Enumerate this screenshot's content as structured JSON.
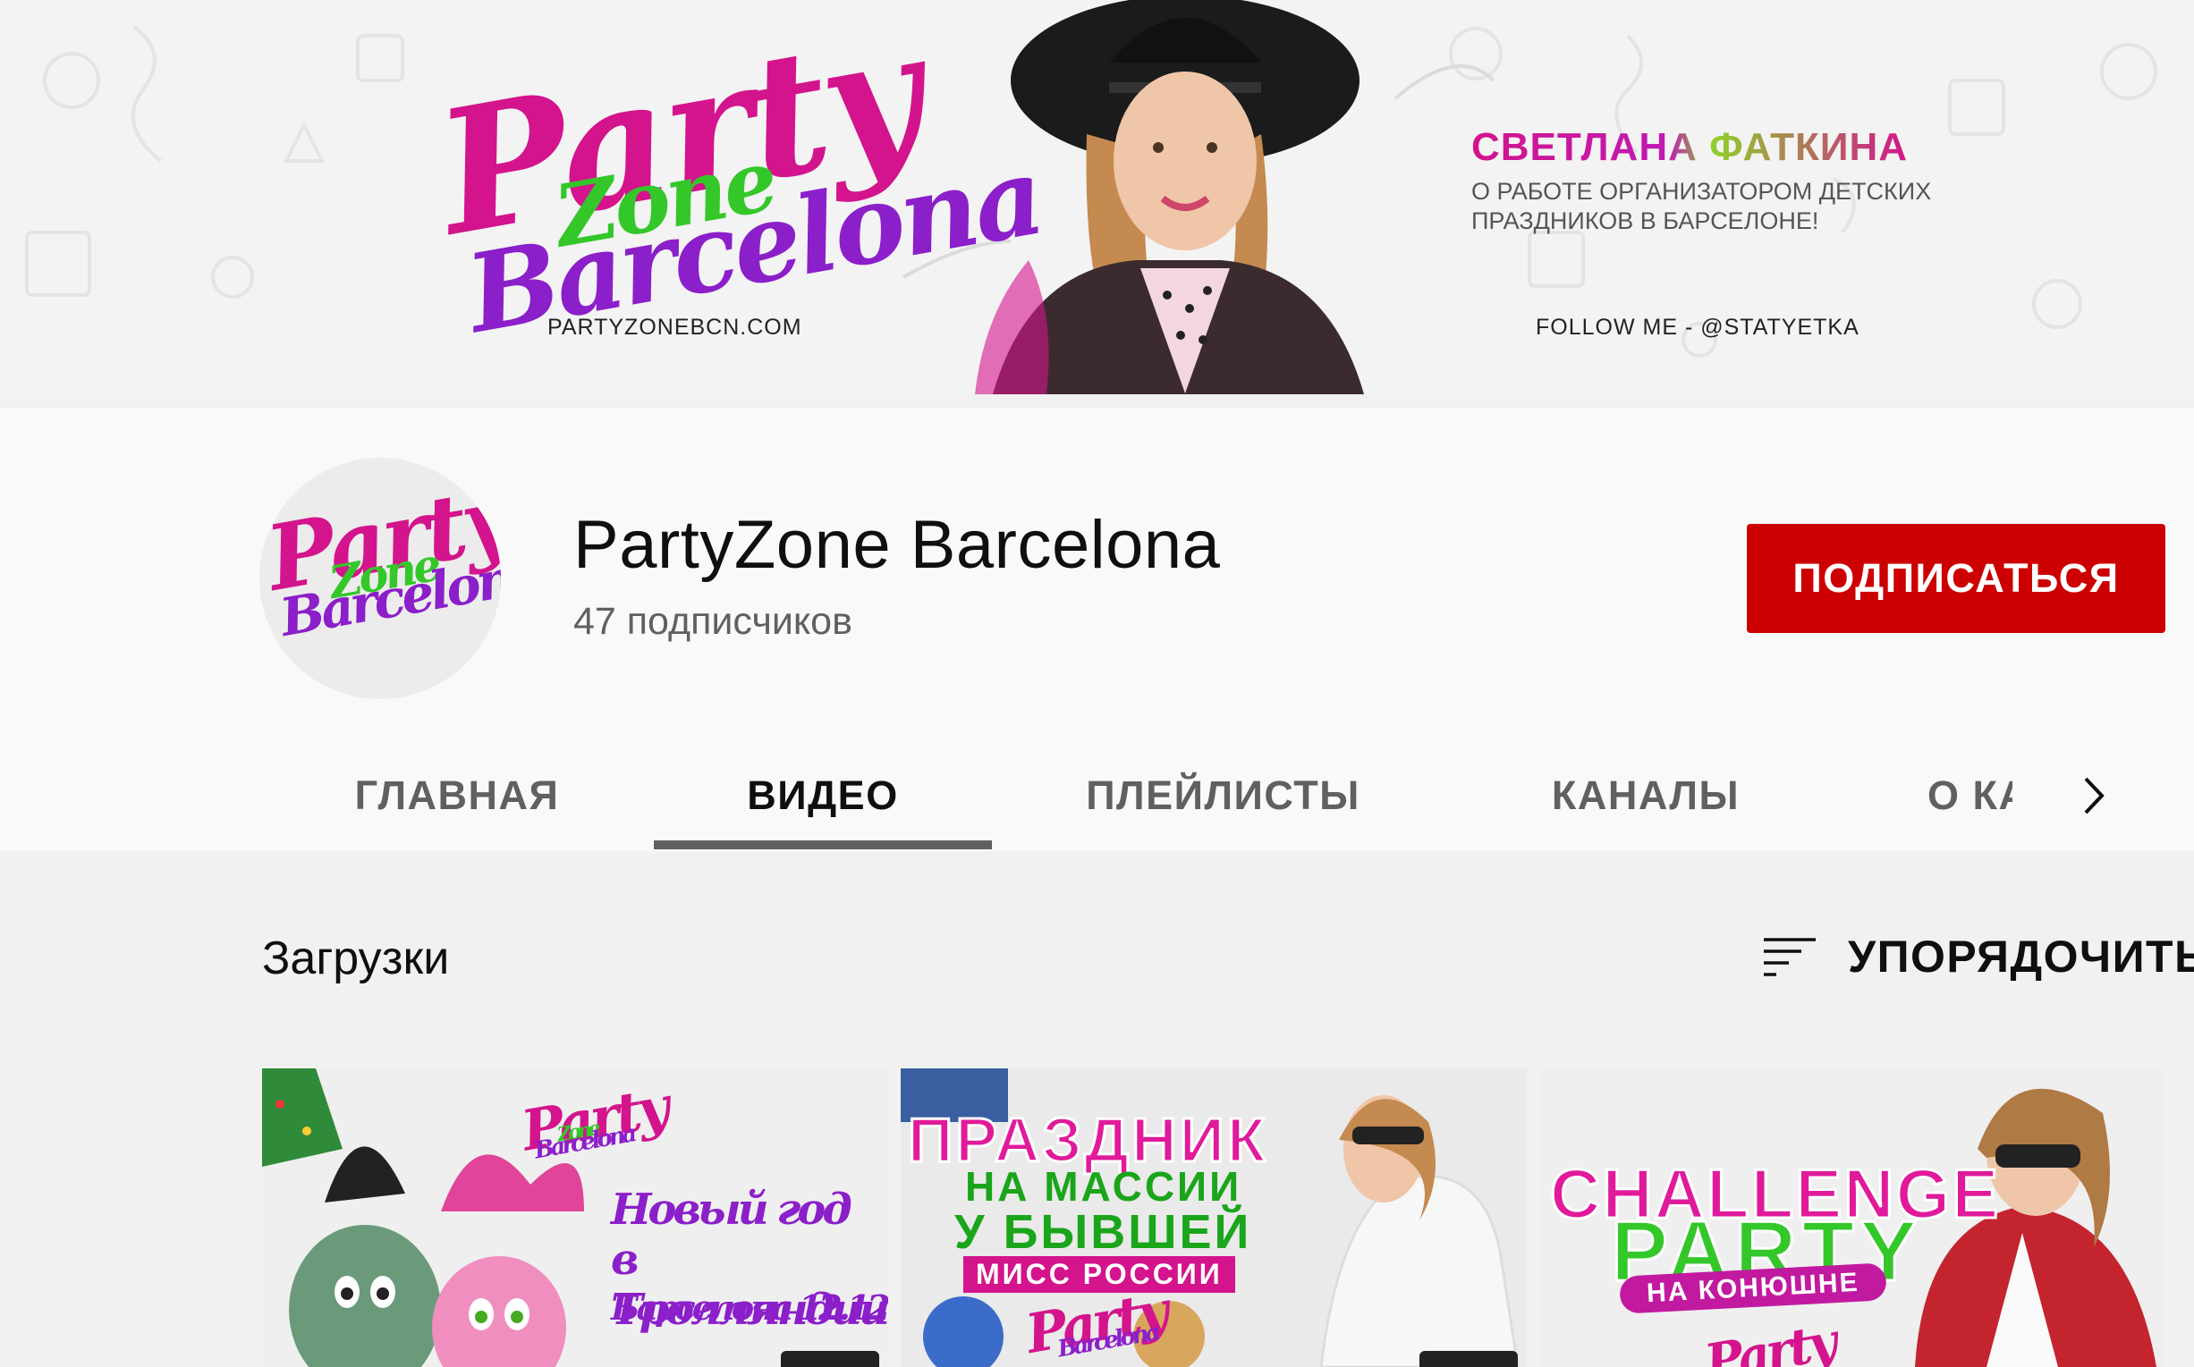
{
  "banner": {
    "logo": {
      "party": "Party",
      "zone": "Zone",
      "barcelona": "Barcelona"
    },
    "website": "PARTYZONEBCN.COM",
    "name": "СВЕТЛАНА ФАТКИНА",
    "about": "О РАБОТЕ ОРГАНИЗАТОРОМ ДЕТСКИХ ПРАЗДНИКОВ В БАРСЕЛОНЕ!",
    "follow": "FOLLOW ME - @STATYETKA"
  },
  "channel": {
    "title": "PartyZone Barcelona",
    "subscribers": "47 подписчиков",
    "subscribe_label": "ПОДПИСАТЬСЯ",
    "subscribe_color": "#cc0000"
  },
  "tabs": [
    {
      "label": "ГЛАВНАЯ"
    },
    {
      "label": "ВИДЕО"
    },
    {
      "label": "ПЛЕЙЛИСТЫ"
    },
    {
      "label": "КАНАЛЫ"
    },
    {
      "label": "О КАНАЛЕ"
    }
  ],
  "active_tab": "ВИДЕО",
  "section": {
    "title": "Загрузки",
    "sort_label": "УПОРЯДОЧИТЬ"
  },
  "videos": [
    {
      "logo": {
        "party": "Party",
        "zone": "Zone",
        "barcelona": "Barcelona"
      },
      "line1": "Новый год",
      "line2": "в Тролляндии",
      "date": "Барселона 12.12"
    },
    {
      "line1": "ПРАЗДНИК",
      "line2": "НА МАССИИ",
      "line3": "У БЫВШЕЙ",
      "badge": "МИСС РОССИИ",
      "logo": {
        "party": "Party",
        "zone": "Zone",
        "barcelona": "Barcelona"
      }
    },
    {
      "line1": "CHALLENGE",
      "line2": "PARTY",
      "badge": "НА КОНЮШНЕ",
      "logo": {
        "party": "Party"
      }
    }
  ],
  "icons": {
    "next": "chevron-right-icon",
    "sort": "sort-icon"
  }
}
